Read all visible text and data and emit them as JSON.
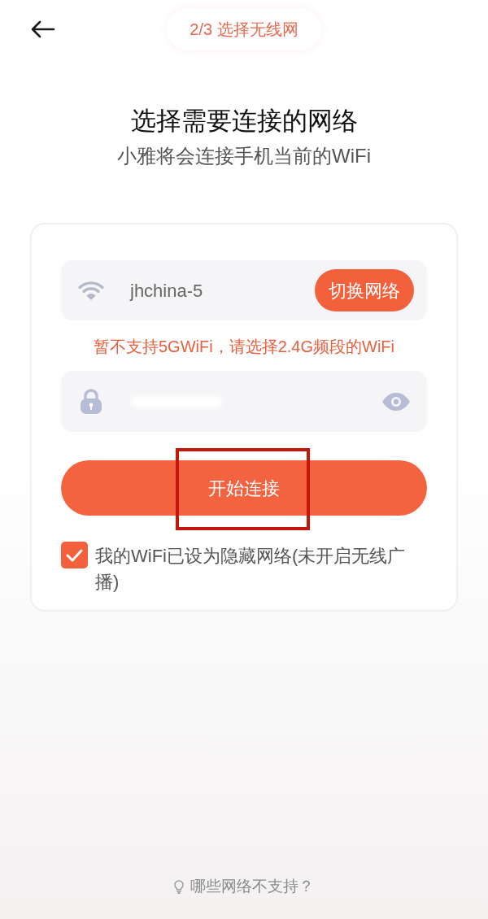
{
  "header": {
    "step": "2/3 选择无线网"
  },
  "heading": {
    "title": "选择需要连接的网络",
    "subtitle": "小雅将会连接手机当前的WiFi"
  },
  "network_field": {
    "value": "jhchina-5",
    "switch_button": "切换网络"
  },
  "warning": "暂不支持5GWiFi，请选择2.4G频段的WiFi",
  "connect_button": {
    "label": "开始连接",
    "highlighted": true
  },
  "hidden_network": {
    "label": "我的WiFi已设为隐藏网络(未开启无线广播)",
    "checked": true
  },
  "help_link": "哪些网络不支持？"
}
